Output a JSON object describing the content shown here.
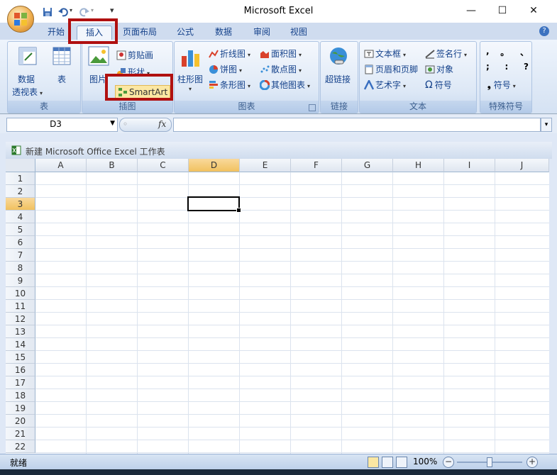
{
  "window": {
    "title": "Microsoft Excel"
  },
  "tabs": [
    "开始",
    "插入",
    "页面布局",
    "公式",
    "数据",
    "审阅",
    "视图"
  ],
  "ribbon": {
    "table_group": {
      "pivot_label_1": "数据",
      "pivot_label_2": "透视表",
      "table_label": "表",
      "group_label": "表"
    },
    "illustration_group": {
      "picture_label": "图片",
      "clipart_label": "剪贴画",
      "shapes_label": "形状",
      "smartart_label": "SmartArt",
      "group_label": "插图"
    },
    "chart_group": {
      "column_label": "柱形图",
      "line_label": "折线图",
      "pie_label": "饼图",
      "bar_label": "条形图",
      "area_label": "面积图",
      "scatter_label": "散点图",
      "other_label": "其他图表",
      "group_label": "图表"
    },
    "link_group": {
      "hyperlink_label": "超链接",
      "group_label": "链接"
    },
    "text_group": {
      "textbox_label": "文本框",
      "header_label": "页眉和页脚",
      "wordart_label": "艺术字",
      "signature_label": "签名行",
      "object_label": "对象",
      "symbol_label": "符号",
      "group_label": "文本"
    },
    "special_group": {
      "chars_row1": [
        ",",
        "。",
        "、"
      ],
      "chars_row2": [
        ";",
        ":",
        "?"
      ],
      "symbol_label": "符号",
      "group_label": "特殊符号"
    }
  },
  "formula_bar": {
    "name_box": "D3",
    "fx": "fx",
    "value": ""
  },
  "workbook": {
    "title": "新建 Microsoft Office Excel 工作表",
    "columns": [
      "A",
      "B",
      "C",
      "D",
      "E",
      "F",
      "G",
      "H",
      "I",
      "J"
    ],
    "rows": [
      "1",
      "2",
      "3",
      "4",
      "5",
      "6",
      "7",
      "8",
      "9",
      "10",
      "11",
      "12",
      "13",
      "14",
      "15",
      "16",
      "17",
      "18",
      "19",
      "20",
      "21",
      "22"
    ],
    "selected_cell": "D3"
  },
  "status": {
    "ready": "就绪",
    "zoom": "100%"
  },
  "colors": {
    "highlight_box": "#b01010",
    "selected_header": "#f1c15f"
  }
}
